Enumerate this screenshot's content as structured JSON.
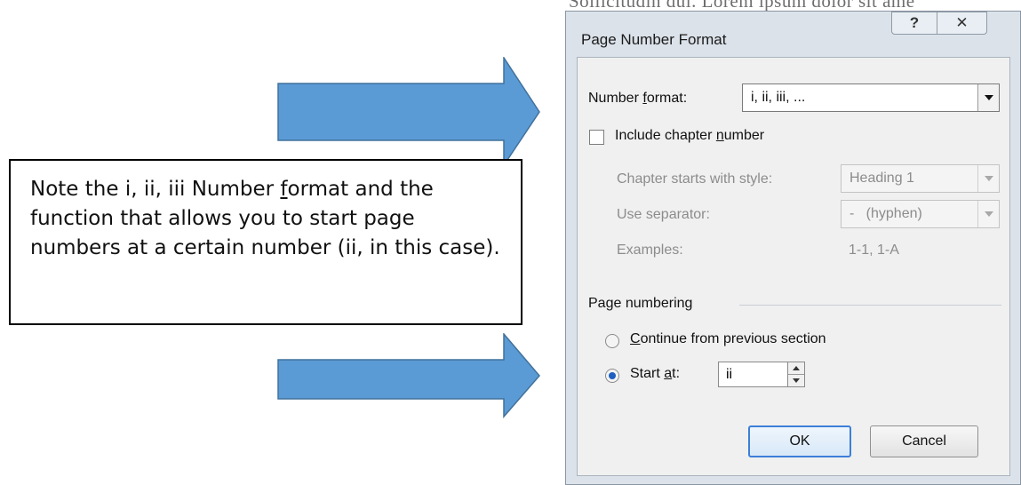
{
  "background_text": "Sollicitudin dui. Lorem ipsum dolor sit ame",
  "note": {
    "pre": "Note the i, ii, iii Number ",
    "underlined": "f",
    "post": "ormat and the function that allows you to start page numbers at a certain number (ii, in this case)."
  },
  "dialog": {
    "title": "Page Number Format",
    "help_icon": "?",
    "close_icon": "✕",
    "number_format": {
      "label_pre": "Number ",
      "label_ul": "f",
      "label_post": "ormat:",
      "value": "i, ii, iii, ..."
    },
    "include_chapter": {
      "label_pre": "Include chapter ",
      "label_ul": "n",
      "label_post": "umber",
      "checked": false
    },
    "chapter_style": {
      "label": "Chapter starts with style:",
      "value": "Heading 1"
    },
    "separator": {
      "label": "Use separator:",
      "value": "-   (hyphen)"
    },
    "examples": {
      "label": "Examples:",
      "value": "1-1, 1-A"
    },
    "page_numbering": {
      "heading": "Page numbering",
      "continue": {
        "label_ul": "C",
        "label_post": "ontinue from previous section",
        "selected": false
      },
      "start_at": {
        "label_pre": "Start ",
        "label_ul": "a",
        "label_post": "t:",
        "value": "ii",
        "selected": true
      }
    },
    "ok_label": "OK",
    "cancel_label": "Cancel"
  },
  "colors": {
    "arrow": "#5b9bd5",
    "arrow_outline": "#41719c",
    "dialog_frame": "#dbe2ea"
  }
}
